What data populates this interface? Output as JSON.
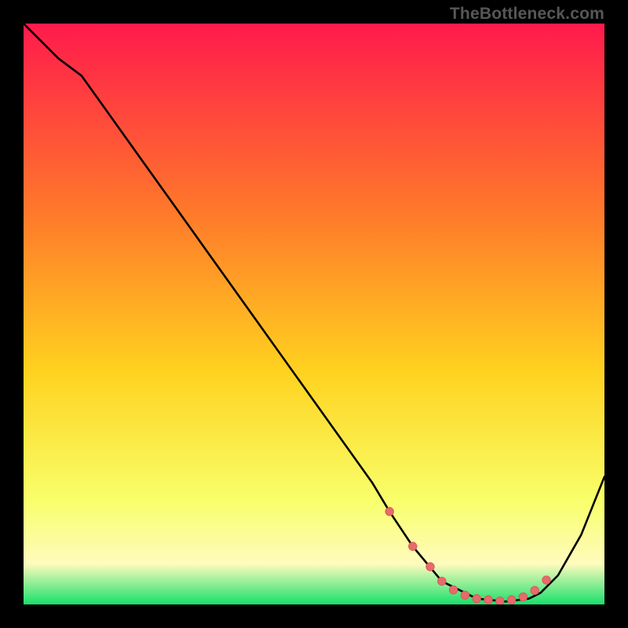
{
  "watermark": "TheBottleneck.com",
  "colors": {
    "background": "#000000",
    "grad_top": "#ff1a4c",
    "grad_mid": "#ffd21f",
    "grad_low": "#fffbbd",
    "grad_bottom": "#18e06b",
    "curve": "#000000",
    "marker_fill": "#e86a6a",
    "marker_stroke": "#d85a5a"
  },
  "chart_data": {
    "type": "line",
    "title": "",
    "xlabel": "",
    "ylabel": "",
    "xlim": [
      0,
      100
    ],
    "ylim": [
      0,
      100
    ],
    "series": [
      {
        "name": "curve",
        "x": [
          0,
          6,
          10,
          20,
          30,
          40,
          50,
          60,
          63,
          67,
          72,
          78,
          83,
          87,
          89,
          92,
          96,
          100
        ],
        "y": [
          100,
          94,
          91,
          77,
          63,
          49,
          35,
          21,
          16,
          10,
          4,
          1,
          0.5,
          1,
          2,
          5,
          12,
          22
        ]
      }
    ],
    "markers": {
      "name": "dots",
      "x": [
        63,
        67,
        70,
        72,
        74,
        76,
        78,
        80,
        82,
        84,
        86,
        88,
        90
      ],
      "y": [
        16,
        10,
        6.5,
        4,
        2.5,
        1.6,
        1,
        0.8,
        0.6,
        0.8,
        1.3,
        2.4,
        4.2
      ]
    }
  }
}
